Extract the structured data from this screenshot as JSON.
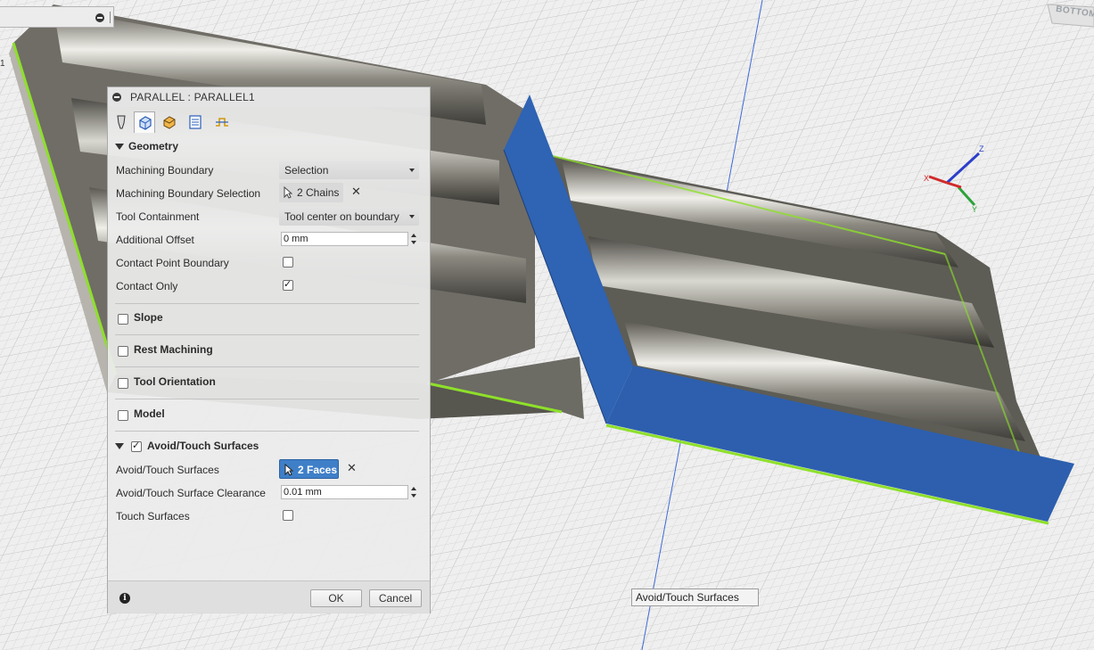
{
  "viewport": {
    "edge_label": "1",
    "viewcube_label": "BOTTOM",
    "tooltip": "Avoid/Touch Surfaces",
    "colors": {
      "face_highlight": "#2f63b3",
      "edge_highlight": "#8ee02a",
      "grid": "#d4d4d4",
      "model": "#8c8980"
    }
  },
  "dialog": {
    "title": "PARALLEL : PARALLEL1",
    "tabs": [
      "tool-icon",
      "geometry-icon",
      "heights-icon",
      "passes-icon",
      "linking-icon"
    ],
    "geometry": {
      "header": "Geometry",
      "machining_boundary_label": "Machining Boundary",
      "machining_boundary_value": "Selection",
      "boundary_selection_label": "Machining Boundary Selection",
      "boundary_selection_value": "2 Chains",
      "tool_containment_label": "Tool Containment",
      "tool_containment_value": "Tool center on boundary",
      "additional_offset_label": "Additional Offset",
      "additional_offset_value": "0 mm",
      "contact_point_boundary_label": "Contact Point Boundary",
      "contact_only_label": "Contact Only"
    },
    "slope_label": "Slope",
    "rest_machining_label": "Rest Machining",
    "tool_orientation_label": "Tool Orientation",
    "model_label": "Model",
    "avoid": {
      "header": "Avoid/Touch Surfaces",
      "surfaces_label": "Avoid/Touch Surfaces",
      "surfaces_value": "2 Faces",
      "clearance_label": "Avoid/Touch Surface Clearance",
      "clearance_value": "0.01 mm",
      "touch_surfaces_label": "Touch Surfaces"
    },
    "ok_label": "OK",
    "cancel_label": "Cancel"
  }
}
